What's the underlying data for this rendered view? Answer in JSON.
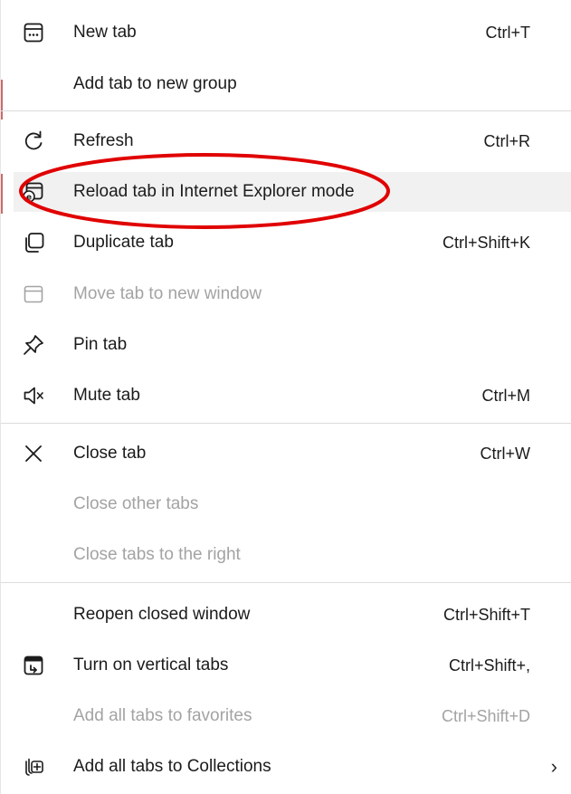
{
  "menu": {
    "items": [
      {
        "label": "New tab",
        "shortcut": "Ctrl+T",
        "icon": "new-tab-icon"
      },
      {
        "label": "Add tab to new group",
        "shortcut": "",
        "icon": ""
      },
      {
        "label": "Refresh",
        "shortcut": "Ctrl+R",
        "icon": "refresh-icon"
      },
      {
        "label": "Reload tab in Internet Explorer mode",
        "shortcut": "",
        "icon": "ie-mode-icon"
      },
      {
        "label": "Duplicate tab",
        "shortcut": "Ctrl+Shift+K",
        "icon": "duplicate-icon"
      },
      {
        "label": "Move tab to new window",
        "shortcut": "",
        "icon": "window-icon",
        "disabled": true
      },
      {
        "label": "Pin tab",
        "shortcut": "",
        "icon": "pin-icon"
      },
      {
        "label": "Mute tab",
        "shortcut": "Ctrl+M",
        "icon": "mute-icon"
      },
      {
        "label": "Close tab",
        "shortcut": "Ctrl+W",
        "icon": "close-icon"
      },
      {
        "label": "Close other tabs",
        "shortcut": "",
        "icon": "",
        "disabled": true
      },
      {
        "label": "Close tabs to the right",
        "shortcut": "",
        "icon": "",
        "disabled": true
      },
      {
        "label": "Reopen closed window",
        "shortcut": "Ctrl+Shift+T",
        "icon": ""
      },
      {
        "label": "Turn on vertical tabs",
        "shortcut": "Ctrl+Shift+,",
        "icon": "vertical-tabs-icon"
      },
      {
        "label": "Add all tabs to favorites",
        "shortcut": "Ctrl+Shift+D",
        "icon": "",
        "disabled": true
      },
      {
        "label": "Add all tabs to Collections",
        "shortcut": "",
        "icon": "collections-icon",
        "submenu_indicator": "›"
      }
    ]
  },
  "colors": {
    "annotation": "#e00000",
    "highlight": "#f1f1f1",
    "text": "#1b1b1b",
    "disabled_text": "#a3a3a3",
    "divider": "#dcdcdc"
  }
}
